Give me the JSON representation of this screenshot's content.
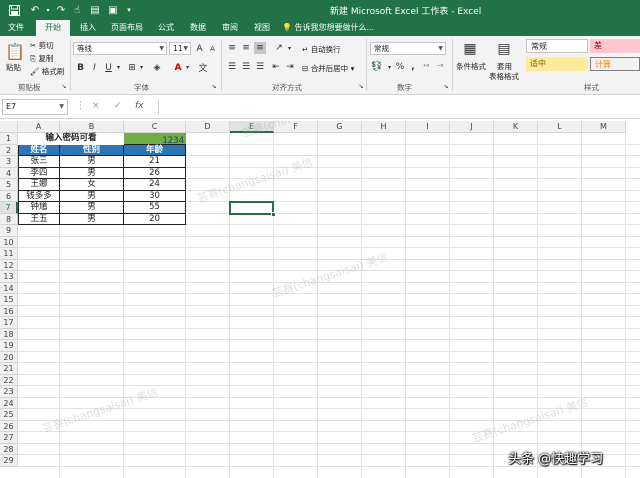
{
  "window": {
    "title": "新建 Microsoft Excel 工作表 - Excel"
  },
  "quick_access": {
    "save_icon": "save-icon",
    "undo_icon": "undo-icon",
    "redo_icon": "redo-icon"
  },
  "tabs": [
    {
      "label": "文件"
    },
    {
      "label": "开始"
    },
    {
      "label": "插入"
    },
    {
      "label": "页面布局"
    },
    {
      "label": "公式"
    },
    {
      "label": "数据"
    },
    {
      "label": "审阅"
    },
    {
      "label": "视图"
    }
  ],
  "tell_me": "告诉我您想要做什么...",
  "ribbon": {
    "clipboard": {
      "paste": "粘贴",
      "cut": "剪切",
      "copy": "复制",
      "format_painter": "格式刷",
      "label": "剪贴板"
    },
    "font": {
      "name": "等线",
      "size": "11",
      "grow": "A",
      "shrink": "A",
      "bold": "B",
      "italic": "I",
      "underline": "U",
      "font_color": "A",
      "label": "字体"
    },
    "alignment": {
      "wrap_text": "自动换行",
      "merge_center": "合并后居中",
      "label": "对齐方式"
    },
    "number": {
      "format": "常规",
      "percent": "%",
      "comma": ",",
      "label": "数字"
    },
    "styles": {
      "conditional": "条件格式",
      "table": "套用",
      "table2": "表格格式",
      "normal": "常规",
      "bad": "差",
      "neutral": "适中",
      "calc": "计算",
      "label": "样式",
      "bad_color": "#ffc7ce",
      "neutral_color": "#ffeb9c",
      "calc_color": "#f2f2f2"
    }
  },
  "formula_bar": {
    "name_box": "E7",
    "cancel": "×",
    "enter": "✓",
    "fx": "fx",
    "value": ""
  },
  "columns": [
    "A",
    "B",
    "C",
    "D",
    "E",
    "F",
    "G",
    "H",
    "I",
    "J",
    "K",
    "L",
    "M"
  ],
  "rows": [
    "1",
    "2",
    "3",
    "4",
    "5",
    "6",
    "7",
    "8",
    "9",
    "10",
    "11",
    "12",
    "13",
    "14",
    "15",
    "16",
    "17",
    "18",
    "19",
    "20",
    "21",
    "22",
    "23",
    "24",
    "25",
    "26",
    "27",
    "28",
    "29"
  ],
  "sheet": {
    "password_prompt": "输入密码可看",
    "password_value": "1234",
    "headers": [
      "姓名",
      "性别",
      "年龄"
    ],
    "data": [
      [
        "张三",
        "男",
        "21"
      ],
      [
        "李四",
        "男",
        "26"
      ],
      [
        "王娜",
        "女",
        "24"
      ],
      [
        "钱多多",
        "男",
        "30"
      ],
      [
        "钟馗",
        "男",
        "55"
      ],
      [
        "王五",
        "男",
        "20"
      ]
    ],
    "header_fill": "#2e75b6",
    "password_fill": "#70ad47",
    "active_cell": "E7"
  },
  "watermarks": [
    "芸赛(changsaisai) 美信",
    "芸赛(changsaisai) 美信",
    "芸赛(changsaisai) 美信",
    "芸赛(changsaisai) 美信",
    "芸赛(changsaisai) 美信"
  ],
  "credit": "头条 @快趣学习"
}
